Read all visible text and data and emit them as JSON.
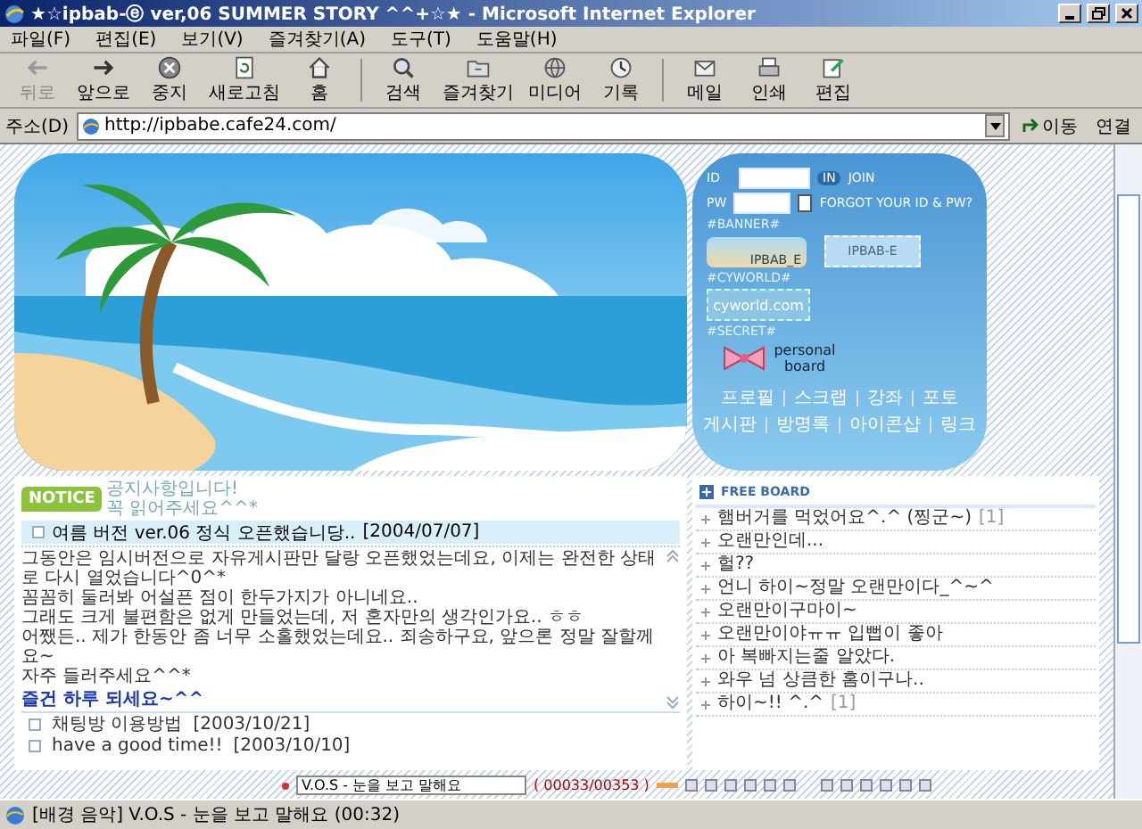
{
  "window": {
    "title": "★☆ipbab-ⓔ ver,06 SUMMER STORY ^^+☆★ - Microsoft Internet Explorer"
  },
  "menu": [
    "파일(F)",
    "편집(E)",
    "보기(V)",
    "즐겨찾기(A)",
    "도구(T)",
    "도움말(H)"
  ],
  "toolbar": [
    {
      "kind": "back",
      "label": "뒤로",
      "disabled": true
    },
    {
      "kind": "forward",
      "label": "앞으로",
      "disabled": false
    },
    {
      "kind": "stop",
      "label": "중지",
      "disabled": false
    },
    {
      "kind": "refresh",
      "label": "새로고침",
      "disabled": false
    },
    {
      "kind": "home",
      "label": "홈",
      "disabled": false
    },
    {
      "kind": "search",
      "label": "검색",
      "disabled": false
    },
    {
      "kind": "favorites",
      "label": "즐겨찾기",
      "disabled": false
    },
    {
      "kind": "media",
      "label": "미디어",
      "disabled": false
    },
    {
      "kind": "history",
      "label": "기록",
      "disabled": false
    },
    {
      "kind": "mail",
      "label": "메일",
      "disabled": false
    },
    {
      "kind": "print",
      "label": "인쇄",
      "disabled": false
    },
    {
      "kind": "edit",
      "label": "편집",
      "disabled": false
    }
  ],
  "address": {
    "label": "주소(D)",
    "url": "http://ipbabe.cafe24.com/",
    "go": "이동",
    "links": "연결"
  },
  "login": {
    "id_label": "ID",
    "pw_label": "PW",
    "login_button": "IN",
    "join": "JOIN",
    "forgot": "FORGOT YOUR ID & PW?",
    "remember_checked": false
  },
  "sidebar": {
    "banner_heading": "#BANNER#",
    "banners": [
      "IPBAB_E",
      "IPBAB-E"
    ],
    "cyworld_heading": "#CYWORLD#",
    "cyworld_link": "cyworld.com",
    "secret_heading": "#SECRET#",
    "personal_board": "personal board",
    "nav_rows": [
      [
        "프로필",
        "스크랩",
        "강좌",
        "포토"
      ],
      [
        "게시판",
        "방명록",
        "아이콘샵",
        "링크"
      ]
    ]
  },
  "notice": {
    "badge": "NOTICE",
    "subtitle": [
      "공지사항입니다!",
      "꼭 읽어주세요^^*"
    ],
    "headline": {
      "title": "여름 버전 ver.06 정식 오픈했습니당..",
      "date": "[2004/07/07]"
    },
    "body": [
      "그동안은 임시버전으로 자유게시판만 달랑 오픈했었는데요, 이제는 완전한 상태로 다시 열었습니다^0^*",
      "꼼꼼히 둘러봐 어설픈 점이 한두가지가 아니네요..",
      "그래도 크게 불편함은 없게 만들었는데, 저 혼자만의 생각인가요.. ㅎㅎ",
      "어쨌든.. 제가 한동안 좀 너무 소홀했었는데요.. 죄송하구요, 앞으론 정말 잘할께요~",
      "자주 들러주세요^^*"
    ],
    "closing": "즐건 하루 되세요~^^",
    "posts": [
      {
        "title": "채팅방 이용방법",
        "date": "[2003/10/21]"
      },
      {
        "title": "have a good time!!",
        "date": "[2003/10/10]"
      }
    ]
  },
  "free_board": {
    "title": "FREE BOARD",
    "items": [
      {
        "title": "햄버거를 먹었어요^.^ (찡군~)",
        "count": "[1]"
      },
      {
        "title": "오랜만인데..."
      },
      {
        "title": "헐??"
      },
      {
        "title": "언니 하이~정말 오랜만이다_^~^"
      },
      {
        "title": "오랜만이구마이~"
      },
      {
        "title": "오랜만이야ㅠㅠ 입뻡이 좋아"
      },
      {
        "title": "아 복빠지는줄 알았다."
      },
      {
        "title": "와우 넘 상큼한 홈이구나.."
      },
      {
        "title": "하이~!! ^.^",
        "count": "[1]"
      }
    ]
  },
  "player": {
    "track": "V.O.S - 눈을 보고 말해요",
    "counter": "( 00033/00353 )"
  },
  "status_bar": "[배경 음악] V.O.S - 눈을 보고 말해요 (00:32)"
}
